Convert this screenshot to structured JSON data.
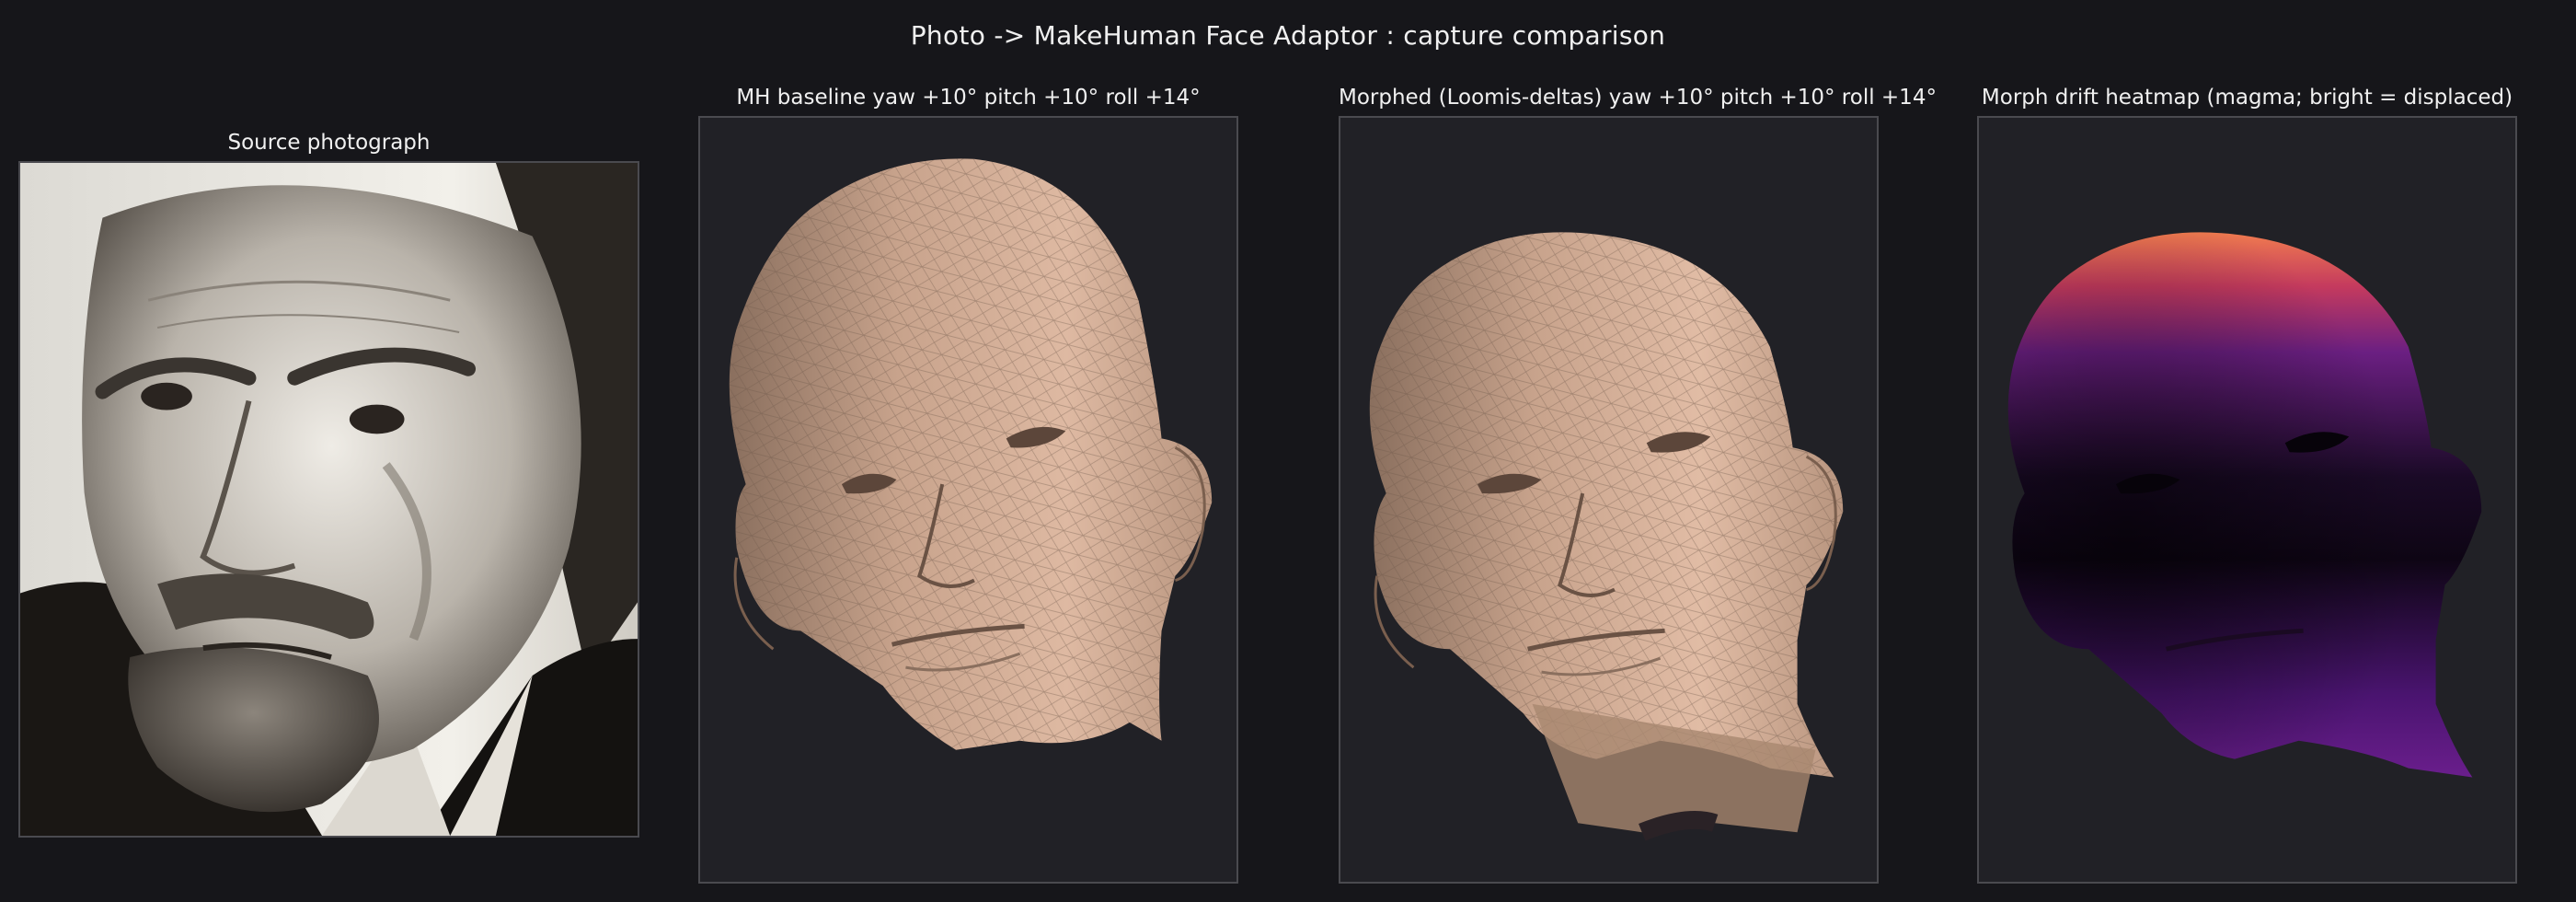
{
  "window": {
    "title": "Photo -> MakeHuman Face Adaptor : capture comparison"
  },
  "panels": [
    {
      "id": "source",
      "title": "Source photograph"
    },
    {
      "id": "baseline",
      "title": "MH baseline  yaw +10°  pitch +10°  roll +14°"
    },
    {
      "id": "morphed",
      "title": "Morphed (Loomis-deltas)  yaw +10°  pitch +10°  roll +14°"
    },
    {
      "id": "heatmap",
      "title": "Morph drift heatmap  (magma; bright = displaced)"
    }
  ],
  "colors": {
    "background": "#16161a",
    "panel_bg": "#212126",
    "frame_border": "#4a4a4f",
    "skin": "#d7b29c",
    "skin_shadow": "#8a6f5e",
    "heat_low": "#14071f",
    "heat_mid": "#7b1c8a",
    "heat_high": "#f07b4f"
  }
}
